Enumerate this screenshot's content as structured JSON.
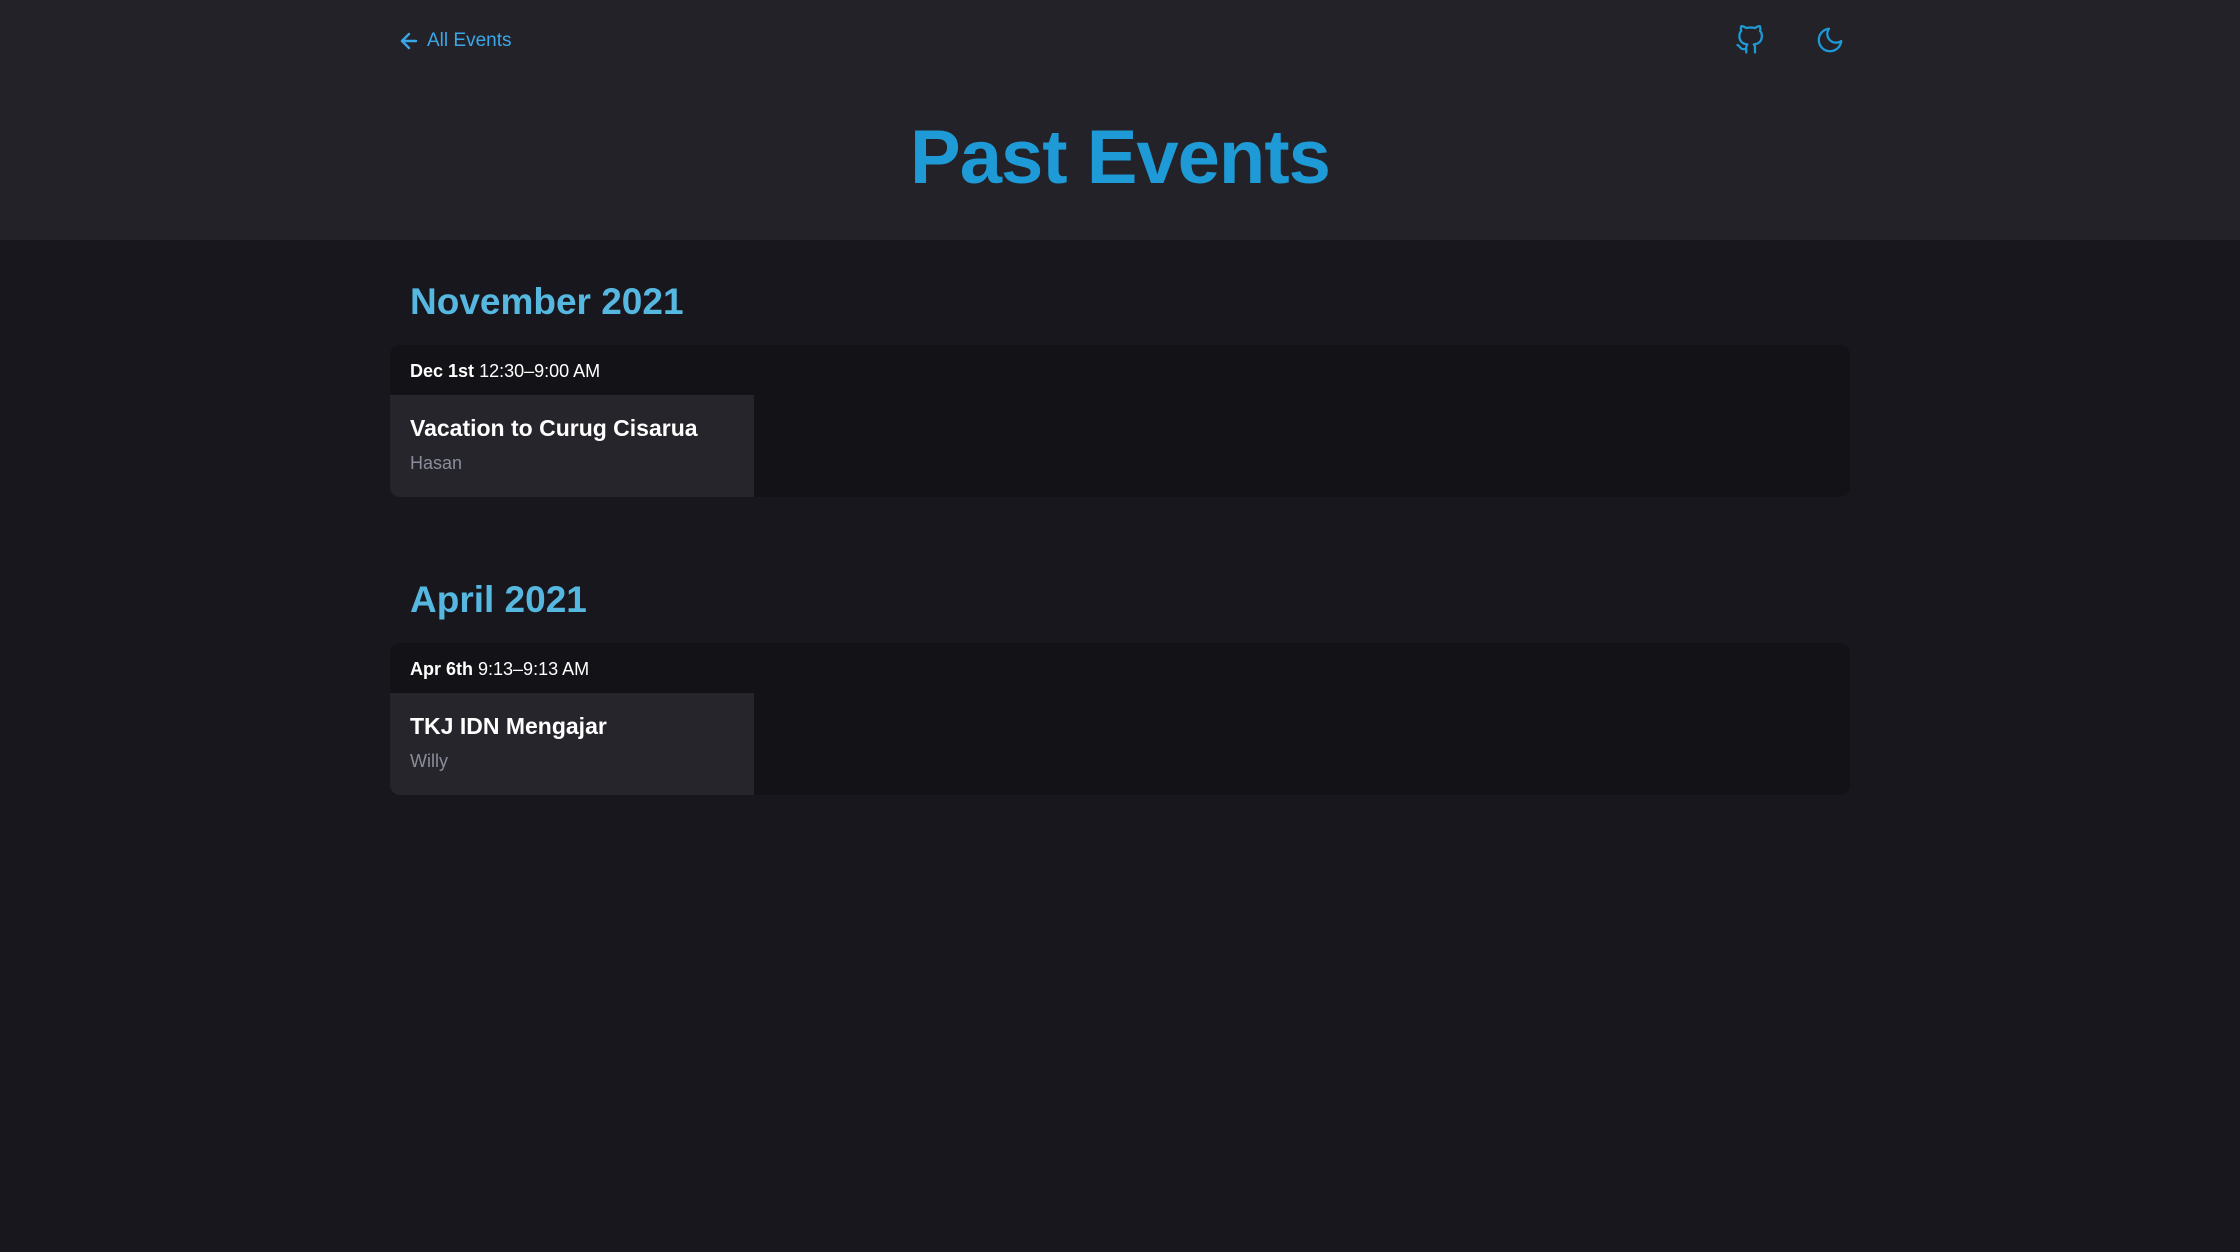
{
  "header": {
    "back_label": "All Events",
    "title": "Past Events",
    "icons": {
      "back": "arrow-left-icon",
      "github": "github-icon",
      "theme": "moon-icon"
    },
    "accent": "#1e9ad6"
  },
  "months": [
    {
      "label": "November 2021",
      "events": [
        {
          "day": "Dec 1st",
          "time": "12:30–9:00 AM",
          "name": "Vacation to Curug Cisarua",
          "host": "Hasan"
        }
      ]
    },
    {
      "label": "April 2021",
      "events": [
        {
          "day": "Apr 6th",
          "time": "9:13–9:13 AM",
          "name": "TKJ IDN Mengajar",
          "host": "Willy"
        }
      ]
    }
  ]
}
